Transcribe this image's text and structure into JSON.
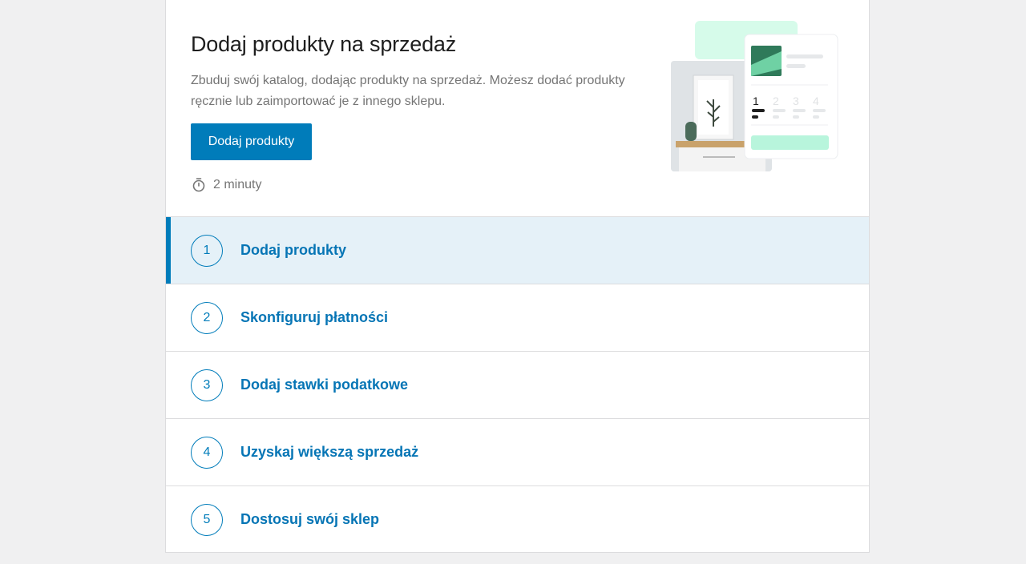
{
  "hero": {
    "title": "Dodaj produkty na sprzedaż",
    "description": "Zbuduj swój katalog, dodając produkty na sprzedaż. Możesz dodać produkty ręcznie lub zaimportować je z innego sklepu.",
    "button_label": "Dodaj produkty",
    "time_estimate": "2 minuty",
    "time_icon": "stopwatch-icon",
    "illustration_steps": [
      "1",
      "2",
      "3",
      "4"
    ]
  },
  "steps": [
    {
      "number": "1",
      "label": "Dodaj produkty",
      "active": true
    },
    {
      "number": "2",
      "label": "Skonfiguruj płatności",
      "active": false
    },
    {
      "number": "3",
      "label": "Dodaj stawki podatkowe",
      "active": false
    },
    {
      "number": "4",
      "label": "Uzyskaj większą sprzedaż",
      "active": false
    },
    {
      "number": "5",
      "label": "Dostosuj swój sklep",
      "active": false
    }
  ],
  "colors": {
    "accent": "#007cba",
    "active_bg": "#e5f1f8",
    "page_bg": "#f0f0f1",
    "mint": "#b8f5dc"
  }
}
